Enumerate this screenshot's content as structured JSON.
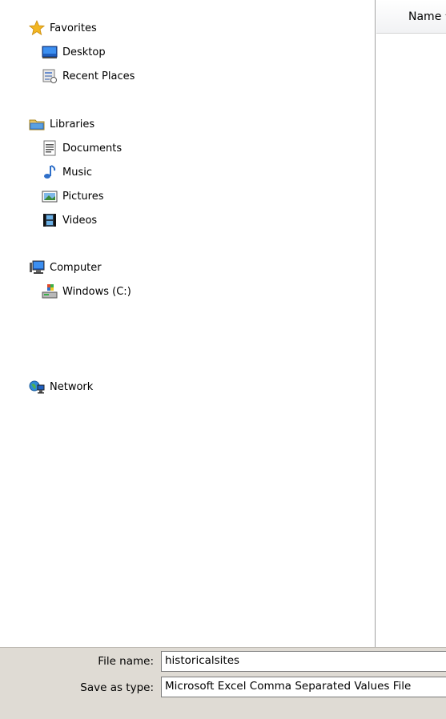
{
  "nav": {
    "favorites": {
      "label": "Favorites",
      "icon": "favorites-star-icon"
    },
    "desktop": {
      "label": "Desktop",
      "icon": "desktop-icon"
    },
    "recent": {
      "label": "Recent Places",
      "icon": "recent-places-icon"
    },
    "libraries": {
      "label": "Libraries",
      "icon": "libraries-icon"
    },
    "documents": {
      "label": "Documents",
      "icon": "documents-icon"
    },
    "music": {
      "label": "Music",
      "icon": "music-icon"
    },
    "pictures": {
      "label": "Pictures",
      "icon": "pictures-icon"
    },
    "videos": {
      "label": "Videos",
      "icon": "videos-icon"
    },
    "computer": {
      "label": "Computer",
      "icon": "computer-icon"
    },
    "windows_c": {
      "label": "Windows (C:)",
      "icon": "drive-icon"
    },
    "network": {
      "label": "Network",
      "icon": "network-icon"
    }
  },
  "filelist": {
    "column_name": "Name",
    "sort_indicator": "^"
  },
  "save": {
    "file_name_label": "File name:",
    "file_name_value": "historicalsites",
    "type_label": "Save as type:",
    "type_value": "Microsoft Excel Comma Separated Values File"
  },
  "colors": {
    "bottom_panel": "#dfdbd4",
    "accent_blue": "#2e6fc9",
    "star_gold": "#f2b622"
  }
}
